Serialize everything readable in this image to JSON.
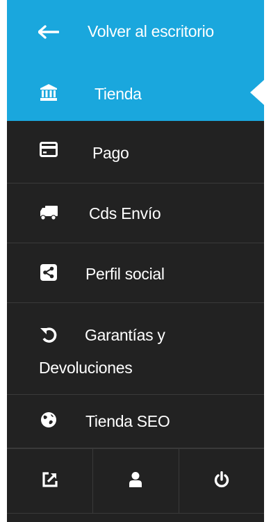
{
  "menu": {
    "back_label": "Volver al escritorio",
    "items": [
      {
        "label": "Tienda",
        "icon": "bank-icon",
        "active": true
      },
      {
        "label": "Pago",
        "icon": "credit-card-icon"
      },
      {
        "label": "Cds Envío",
        "icon": "truck-icon"
      },
      {
        "label": "Perfil social",
        "icon": "share-icon"
      },
      {
        "label_line1": "Garantías y",
        "label_line2": "Devoluciones",
        "icon": "undo-icon"
      },
      {
        "label": "Tienda SEO",
        "icon": "globe-icon"
      }
    ]
  },
  "footer": {
    "buttons": [
      {
        "icon": "external-link-icon"
      },
      {
        "icon": "user-icon"
      },
      {
        "icon": "power-icon"
      }
    ]
  },
  "colors": {
    "accent": "#1aa7dd",
    "sidebar_bg": "#222222",
    "text": "#ffffff"
  }
}
